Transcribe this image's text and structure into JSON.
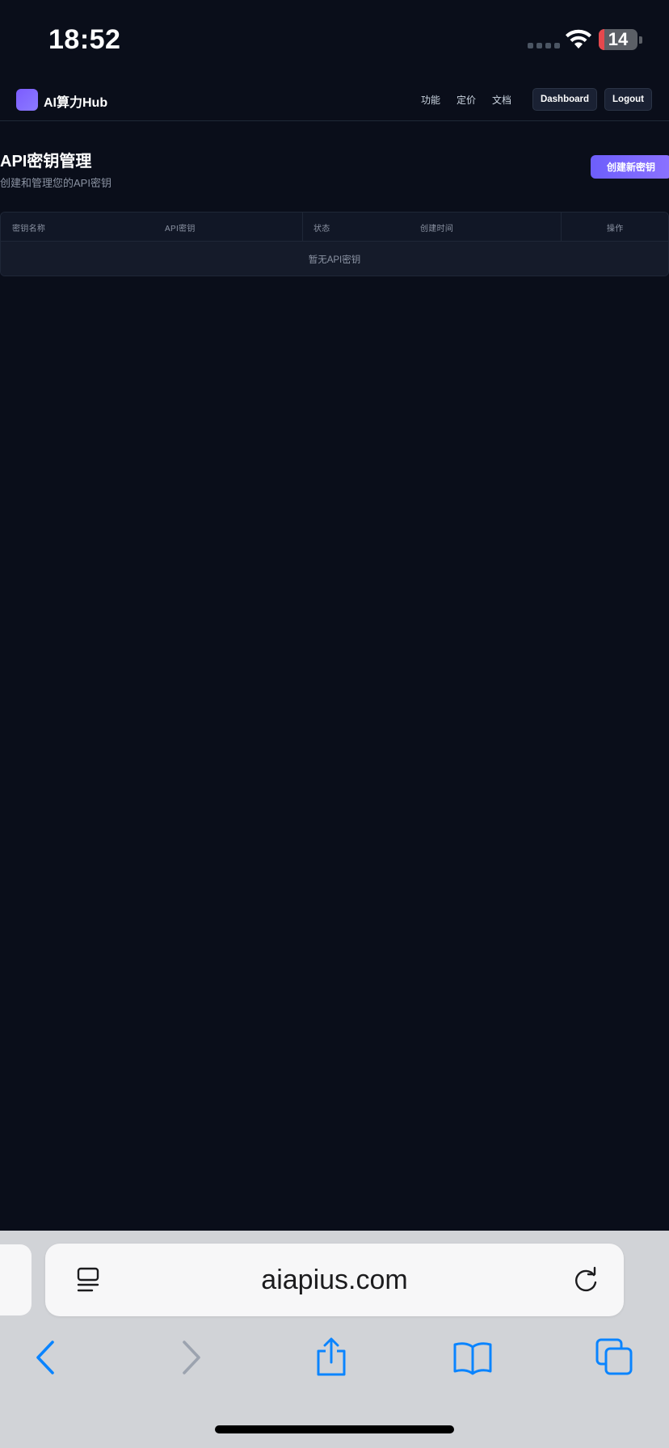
{
  "status_bar": {
    "time": "18:52",
    "battery_level": 14,
    "battery_text": "14"
  },
  "nav": {
    "brand": "AI算力Hub",
    "links": [
      "功能",
      "定价",
      "文档"
    ],
    "dashboard_label": "Dashboard",
    "logout_label": "Logout"
  },
  "page": {
    "title": "API密钥管理",
    "subtitle": "创建和管理您的API密钥",
    "create_button": "创建新密钥"
  },
  "table": {
    "columns": [
      "密钥名称",
      "API密钥",
      "状态",
      "创建时间",
      "操作"
    ],
    "empty_text": "暂无API密钥"
  },
  "browser": {
    "url": "aiapius.com"
  },
  "colors": {
    "background": "#0a0e1a",
    "accent": "#7c5cff",
    "battery_low": "#e5484d",
    "safari_blue": "#0a84ff"
  }
}
